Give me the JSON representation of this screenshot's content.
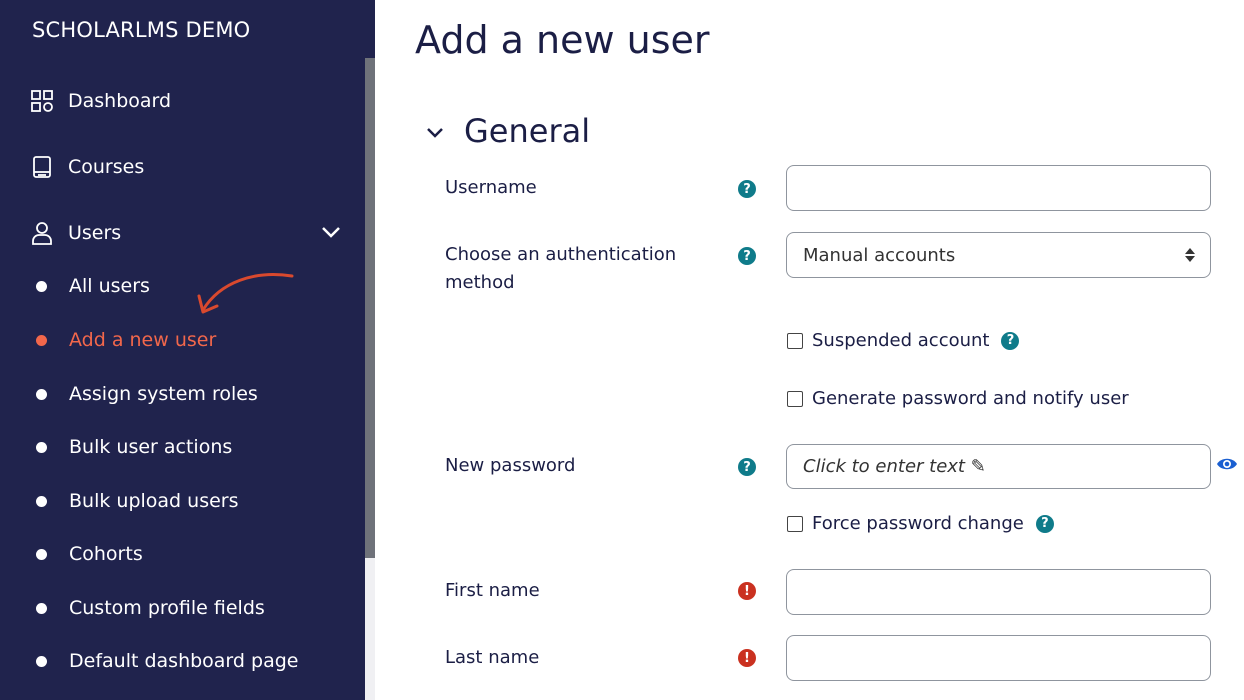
{
  "brand": "SCHOLARLMS DEMO",
  "sidebar": {
    "items": [
      {
        "label": "Dashboard",
        "icon": "dashboard-grid-icon"
      },
      {
        "label": "Courses",
        "icon": "book-icon"
      },
      {
        "label": "Users",
        "icon": "user-icon"
      }
    ],
    "users_submenu": [
      {
        "label": "All users"
      },
      {
        "label": "Add a new user",
        "active": true
      },
      {
        "label": "Assign system roles"
      },
      {
        "label": "Bulk user actions"
      },
      {
        "label": "Bulk upload users"
      },
      {
        "label": "Cohorts"
      },
      {
        "label": "Custom profile fields"
      },
      {
        "label": "Default dashboard page"
      }
    ]
  },
  "page": {
    "title": "Add a new user",
    "section_title": "General"
  },
  "form": {
    "username_label": "Username",
    "auth_label": "Choose an authentication method",
    "auth_value": "Manual accounts",
    "suspended_label": "Suspended account",
    "generate_password_label": "Generate password and notify user",
    "new_password_label": "New password",
    "new_password_placeholder": "Click to enter text ✎",
    "force_password_label": "Force password change",
    "first_name_label": "First name",
    "last_name_label": "Last name"
  },
  "colors": {
    "sidebar_bg": "#20234d",
    "active": "#f2674b",
    "help": "#0f7b8a",
    "required": "#ca3120"
  }
}
